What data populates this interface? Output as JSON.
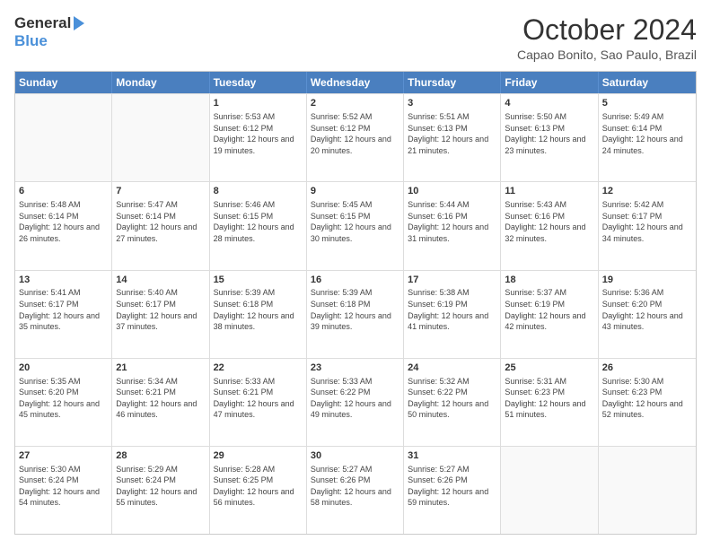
{
  "header": {
    "logo_general": "General",
    "logo_blue": "Blue",
    "month_title": "October 2024",
    "location": "Capao Bonito, Sao Paulo, Brazil"
  },
  "calendar": {
    "days_of_week": [
      "Sunday",
      "Monday",
      "Tuesday",
      "Wednesday",
      "Thursday",
      "Friday",
      "Saturday"
    ],
    "rows": [
      [
        {
          "day": "",
          "sunrise": "",
          "sunset": "",
          "daylight": ""
        },
        {
          "day": "",
          "sunrise": "",
          "sunset": "",
          "daylight": ""
        },
        {
          "day": "1",
          "sunrise": "Sunrise: 5:53 AM",
          "sunset": "Sunset: 6:12 PM",
          "daylight": "Daylight: 12 hours and 19 minutes."
        },
        {
          "day": "2",
          "sunrise": "Sunrise: 5:52 AM",
          "sunset": "Sunset: 6:12 PM",
          "daylight": "Daylight: 12 hours and 20 minutes."
        },
        {
          "day": "3",
          "sunrise": "Sunrise: 5:51 AM",
          "sunset": "Sunset: 6:13 PM",
          "daylight": "Daylight: 12 hours and 21 minutes."
        },
        {
          "day": "4",
          "sunrise": "Sunrise: 5:50 AM",
          "sunset": "Sunset: 6:13 PM",
          "daylight": "Daylight: 12 hours and 23 minutes."
        },
        {
          "day": "5",
          "sunrise": "Sunrise: 5:49 AM",
          "sunset": "Sunset: 6:14 PM",
          "daylight": "Daylight: 12 hours and 24 minutes."
        }
      ],
      [
        {
          "day": "6",
          "sunrise": "Sunrise: 5:48 AM",
          "sunset": "Sunset: 6:14 PM",
          "daylight": "Daylight: 12 hours and 26 minutes."
        },
        {
          "day": "7",
          "sunrise": "Sunrise: 5:47 AM",
          "sunset": "Sunset: 6:14 PM",
          "daylight": "Daylight: 12 hours and 27 minutes."
        },
        {
          "day": "8",
          "sunrise": "Sunrise: 5:46 AM",
          "sunset": "Sunset: 6:15 PM",
          "daylight": "Daylight: 12 hours and 28 minutes."
        },
        {
          "day": "9",
          "sunrise": "Sunrise: 5:45 AM",
          "sunset": "Sunset: 6:15 PM",
          "daylight": "Daylight: 12 hours and 30 minutes."
        },
        {
          "day": "10",
          "sunrise": "Sunrise: 5:44 AM",
          "sunset": "Sunset: 6:16 PM",
          "daylight": "Daylight: 12 hours and 31 minutes."
        },
        {
          "day": "11",
          "sunrise": "Sunrise: 5:43 AM",
          "sunset": "Sunset: 6:16 PM",
          "daylight": "Daylight: 12 hours and 32 minutes."
        },
        {
          "day": "12",
          "sunrise": "Sunrise: 5:42 AM",
          "sunset": "Sunset: 6:17 PM",
          "daylight": "Daylight: 12 hours and 34 minutes."
        }
      ],
      [
        {
          "day": "13",
          "sunrise": "Sunrise: 5:41 AM",
          "sunset": "Sunset: 6:17 PM",
          "daylight": "Daylight: 12 hours and 35 minutes."
        },
        {
          "day": "14",
          "sunrise": "Sunrise: 5:40 AM",
          "sunset": "Sunset: 6:17 PM",
          "daylight": "Daylight: 12 hours and 37 minutes."
        },
        {
          "day": "15",
          "sunrise": "Sunrise: 5:39 AM",
          "sunset": "Sunset: 6:18 PM",
          "daylight": "Daylight: 12 hours and 38 minutes."
        },
        {
          "day": "16",
          "sunrise": "Sunrise: 5:39 AM",
          "sunset": "Sunset: 6:18 PM",
          "daylight": "Daylight: 12 hours and 39 minutes."
        },
        {
          "day": "17",
          "sunrise": "Sunrise: 5:38 AM",
          "sunset": "Sunset: 6:19 PM",
          "daylight": "Daylight: 12 hours and 41 minutes."
        },
        {
          "day": "18",
          "sunrise": "Sunrise: 5:37 AM",
          "sunset": "Sunset: 6:19 PM",
          "daylight": "Daylight: 12 hours and 42 minutes."
        },
        {
          "day": "19",
          "sunrise": "Sunrise: 5:36 AM",
          "sunset": "Sunset: 6:20 PM",
          "daylight": "Daylight: 12 hours and 43 minutes."
        }
      ],
      [
        {
          "day": "20",
          "sunrise": "Sunrise: 5:35 AM",
          "sunset": "Sunset: 6:20 PM",
          "daylight": "Daylight: 12 hours and 45 minutes."
        },
        {
          "day": "21",
          "sunrise": "Sunrise: 5:34 AM",
          "sunset": "Sunset: 6:21 PM",
          "daylight": "Daylight: 12 hours and 46 minutes."
        },
        {
          "day": "22",
          "sunrise": "Sunrise: 5:33 AM",
          "sunset": "Sunset: 6:21 PM",
          "daylight": "Daylight: 12 hours and 47 minutes."
        },
        {
          "day": "23",
          "sunrise": "Sunrise: 5:33 AM",
          "sunset": "Sunset: 6:22 PM",
          "daylight": "Daylight: 12 hours and 49 minutes."
        },
        {
          "day": "24",
          "sunrise": "Sunrise: 5:32 AM",
          "sunset": "Sunset: 6:22 PM",
          "daylight": "Daylight: 12 hours and 50 minutes."
        },
        {
          "day": "25",
          "sunrise": "Sunrise: 5:31 AM",
          "sunset": "Sunset: 6:23 PM",
          "daylight": "Daylight: 12 hours and 51 minutes."
        },
        {
          "day": "26",
          "sunrise": "Sunrise: 5:30 AM",
          "sunset": "Sunset: 6:23 PM",
          "daylight": "Daylight: 12 hours and 52 minutes."
        }
      ],
      [
        {
          "day": "27",
          "sunrise": "Sunrise: 5:30 AM",
          "sunset": "Sunset: 6:24 PM",
          "daylight": "Daylight: 12 hours and 54 minutes."
        },
        {
          "day": "28",
          "sunrise": "Sunrise: 5:29 AM",
          "sunset": "Sunset: 6:24 PM",
          "daylight": "Daylight: 12 hours and 55 minutes."
        },
        {
          "day": "29",
          "sunrise": "Sunrise: 5:28 AM",
          "sunset": "Sunset: 6:25 PM",
          "daylight": "Daylight: 12 hours and 56 minutes."
        },
        {
          "day": "30",
          "sunrise": "Sunrise: 5:27 AM",
          "sunset": "Sunset: 6:26 PM",
          "daylight": "Daylight: 12 hours and 58 minutes."
        },
        {
          "day": "31",
          "sunrise": "Sunrise: 5:27 AM",
          "sunset": "Sunset: 6:26 PM",
          "daylight": "Daylight: 12 hours and 59 minutes."
        },
        {
          "day": "",
          "sunrise": "",
          "sunset": "",
          "daylight": ""
        },
        {
          "day": "",
          "sunrise": "",
          "sunset": "",
          "daylight": ""
        }
      ]
    ]
  }
}
